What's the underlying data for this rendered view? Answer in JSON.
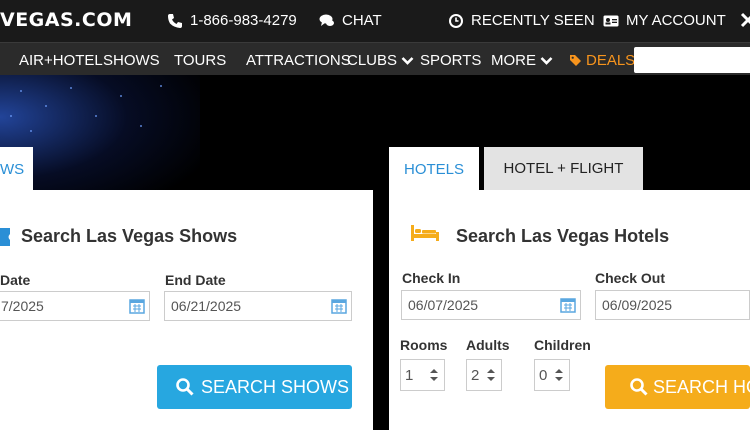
{
  "header": {
    "logo": "VEGAS.COM",
    "phone": "1-866-983-4279",
    "chat": "CHAT",
    "recently_seen": "RECENTLY SEEN",
    "my_account": "MY ACCOUNT"
  },
  "nav": {
    "items": [
      "AIR+HOTEL",
      "SHOWS",
      "TOURS",
      "ATTRACTIONS",
      "CLUBS",
      "SPORTS",
      "MORE",
      "DEALS"
    ],
    "search_placeholder": ""
  },
  "shows_panel": {
    "tab_label": "WS",
    "title": "Search Las Vegas Shows",
    "start_label": "Date",
    "start_value": "7/2025",
    "end_label": "End Date",
    "end_value": "06/21/2025",
    "button": "SEARCH SHOWS"
  },
  "hotels_panel": {
    "tabs": [
      "HOTELS",
      "HOTEL + FLIGHT"
    ],
    "title": "Search Las Vegas Hotels",
    "checkin_label": "Check In",
    "checkin_value": "06/07/2025",
    "checkout_label": "Check Out",
    "checkout_value": "06/09/2025",
    "rooms_label": "Rooms",
    "rooms_value": "1",
    "adults_label": "Adults",
    "adults_value": "2",
    "children_label": "Children",
    "children_value": "0",
    "button": "SEARCH HO"
  },
  "colors": {
    "accent_blue": "#27a7e0",
    "accent_orange": "#f5ac1b",
    "deals_orange": "#f7941d",
    "tab_blue": "#2a8fd6"
  },
  "icons": [
    "phone-icon",
    "chat-icon",
    "clock-icon",
    "account-card-icon",
    "close-icon",
    "chevron-down-icon",
    "tag-icon",
    "ticket-icon",
    "bed-icon",
    "calendar-icon",
    "search-icon"
  ]
}
